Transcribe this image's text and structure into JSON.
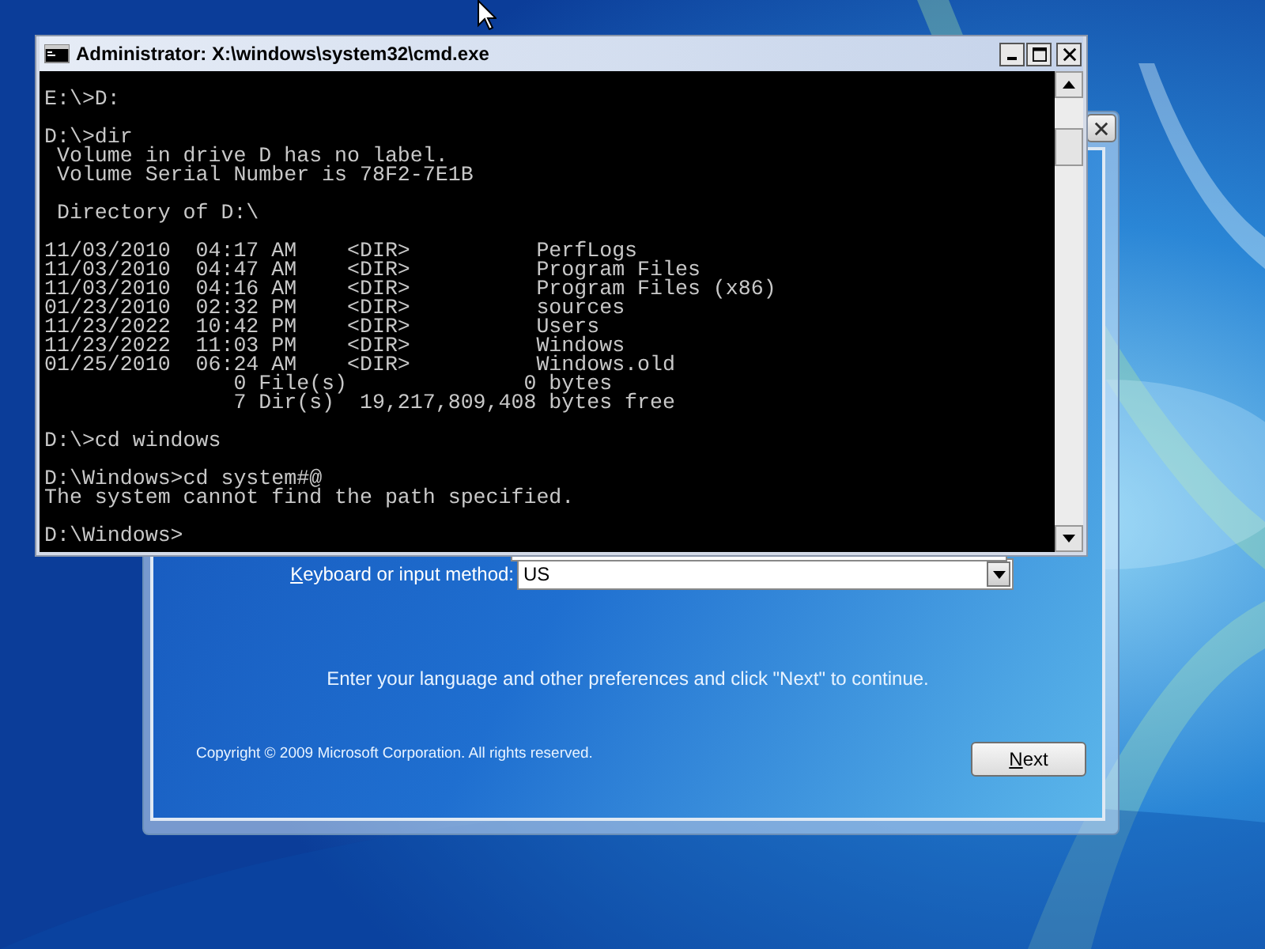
{
  "setup_window": {
    "keyboard": {
      "label": "Keyboard or input method:",
      "access_key_underlined": true,
      "value": "US"
    },
    "instruction": "Enter your language and other preferences and click \"Next\" to continue.",
    "copyright": "Copyright © 2009 Microsoft Corporation. All rights reserved.",
    "next_button": {
      "label": "Next",
      "access_key_underlined": true
    }
  },
  "cmd_window": {
    "title": "Administrator: X:\\windows\\system32\\cmd.exe",
    "blocks": [
      [
        "E:\\>D:"
      ],
      [
        "D:\\>dir",
        " Volume in drive D has no label.",
        " Volume Serial Number is 78F2-7E1B"
      ],
      [
        " Directory of D:\\"
      ],
      [
        "11/03/2010  04:17 AM    <DIR>          PerfLogs",
        "11/03/2010  04:47 AM    <DIR>          Program Files",
        "11/03/2010  04:16 AM    <DIR>          Program Files (x86)",
        "01/23/2010  02:32 PM    <DIR>          sources",
        "11/23/2022  10:42 PM    <DIR>          Users",
        "11/23/2022  11:03 PM    <DIR>          Windows",
        "01/25/2010  06:24 AM    <DIR>          Windows.old",
        "               0 File(s)              0 bytes",
        "               7 Dir(s)  19,217,809,408 bytes free"
      ],
      [
        "D:\\>cd windows"
      ],
      [
        "D:\\Windows>cd system#@",
        "The system cannot find the path specified."
      ],
      [
        "D:\\Windows>"
      ]
    ]
  }
}
